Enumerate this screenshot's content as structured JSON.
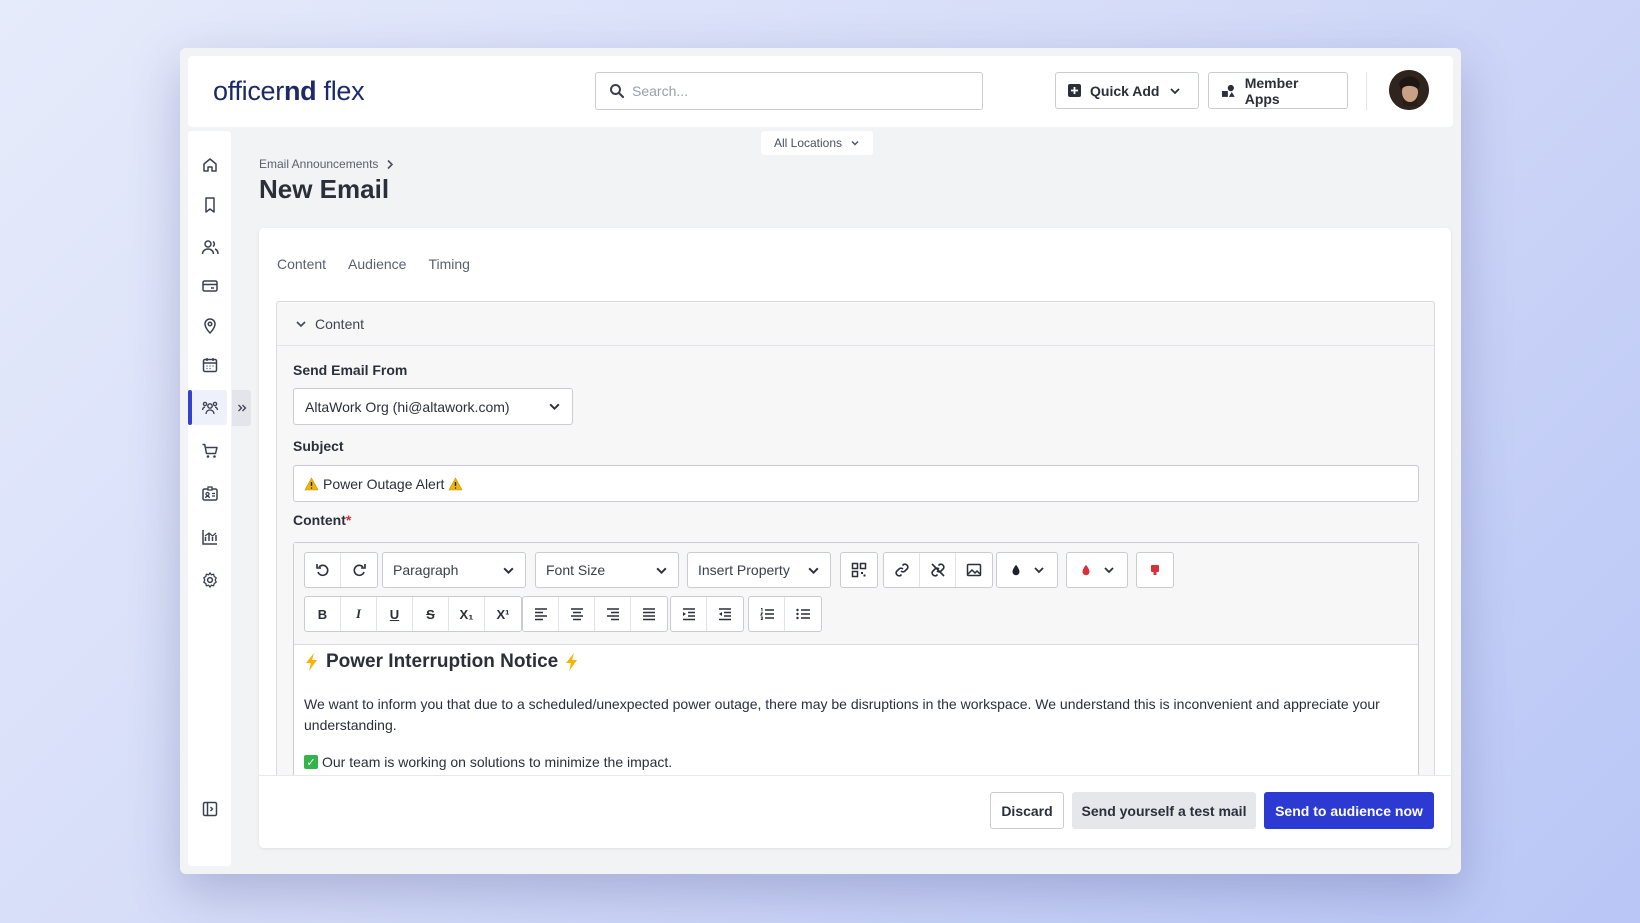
{
  "header": {
    "logo_light": "officer",
    "logo_bold": "nd",
    "logo_suffix": " flex",
    "search_placeholder": "Search...",
    "quick_add_label": "Quick Add",
    "member_apps_label": "Member Apps"
  },
  "location_filter": {
    "label": "All Locations"
  },
  "sidebar": {
    "items": [
      "home-icon",
      "bookmark-icon",
      "users-icon",
      "billing-card-icon",
      "location-pin-icon",
      "calendar-icon",
      "community-icon",
      "cart-icon",
      "member-id-icon",
      "analytics-icon",
      "settings-icon"
    ],
    "active": "community-icon",
    "collapse": "sidebar-toggle-icon"
  },
  "breadcrumb": {
    "parent": "Email Announcements"
  },
  "page": {
    "title": "New Email"
  },
  "tabs": [
    "Content",
    "Audience",
    "Timing"
  ],
  "section": {
    "title": "Content"
  },
  "form": {
    "send_from_label": "Send Email From",
    "send_from_value": "AltaWork Org (hi@altawork.com)",
    "subject_label": "Subject",
    "subject_value": "Power Outage Alert",
    "content_label": "Content",
    "required_mark": "*"
  },
  "toolbar": {
    "paragraph": "Paragraph",
    "font_size": "Font Size",
    "insert_property": "Insert Property",
    "bold": "B",
    "italic": "I",
    "underline": "U",
    "strike": "S",
    "subscript": "X₁",
    "superscript": "X¹"
  },
  "editor": {
    "heading": "Power Interruption Notice",
    "paragraph": "We want to inform you that due to a scheduled/unexpected power outage, there may be disruptions in the workspace. We understand this is inconvenient and appreciate your understanding.",
    "bullet": "Our team is working on solutions to minimize the impact."
  },
  "footer": {
    "discard": "Discard",
    "test_mail": "Send yourself a test mail",
    "send_now": "Send to audience now"
  },
  "colors": {
    "primary": "#2d3ad1",
    "danger": "#d6303a"
  }
}
